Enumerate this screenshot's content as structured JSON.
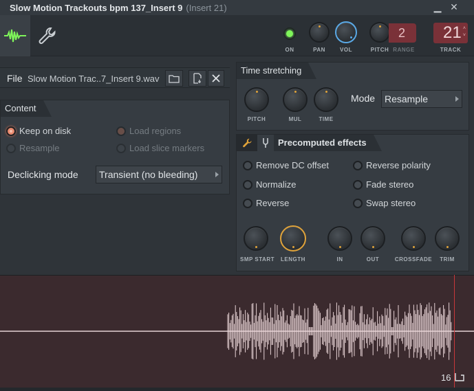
{
  "window": {
    "title": "Slow Motion Trackouts bpm 137_Insert 9",
    "subtitle": "(Insert 21)"
  },
  "toolbar": {
    "on_label": "ON",
    "pan_label": "PAN",
    "vol_label": "VOL",
    "pitch_label": "PITCH",
    "range_label": "RANGE",
    "range_value": "2",
    "track_label": "TRACK",
    "track_value": "21"
  },
  "file": {
    "label": "File",
    "name": "Slow Motion Trac..7_Insert 9.wav"
  },
  "content": {
    "header": "Content",
    "options": [
      {
        "label": "Keep on disk",
        "checked": true,
        "enabled": true
      },
      {
        "label": "Load regions",
        "checked": true,
        "enabled": false
      },
      {
        "label": "Resample",
        "checked": false,
        "enabled": false
      },
      {
        "label": "Load slice markers",
        "checked": false,
        "enabled": false
      }
    ],
    "declicking_label": "Declicking mode",
    "declicking_value": "Transient (no bleeding)"
  },
  "time_stretching": {
    "header": "Time stretching",
    "knobs": [
      "PITCH",
      "MUL",
      "TIME"
    ],
    "mode_label": "Mode",
    "mode_value": "Resample"
  },
  "precomputed": {
    "header": "Precomputed effects",
    "effects": [
      "Remove DC offset",
      "Reverse polarity",
      "Normalize",
      "Fade stereo",
      "Reverse",
      "Swap stereo"
    ],
    "knobs": [
      "SMP START",
      "LENGTH",
      "IN",
      "OUT",
      "CROSSFADE",
      "TRIM"
    ]
  },
  "waveform": {
    "marker_value": "16",
    "colors": {
      "background": "#3b2a2e",
      "wave": "#e8d4d6",
      "playhead": "#c9383a"
    }
  },
  "colors": {
    "accent_orange": "#e0a33a",
    "vol_blue": "#5aa9e6",
    "on_green": "#7ff55a",
    "display_red": "#7a3138"
  }
}
